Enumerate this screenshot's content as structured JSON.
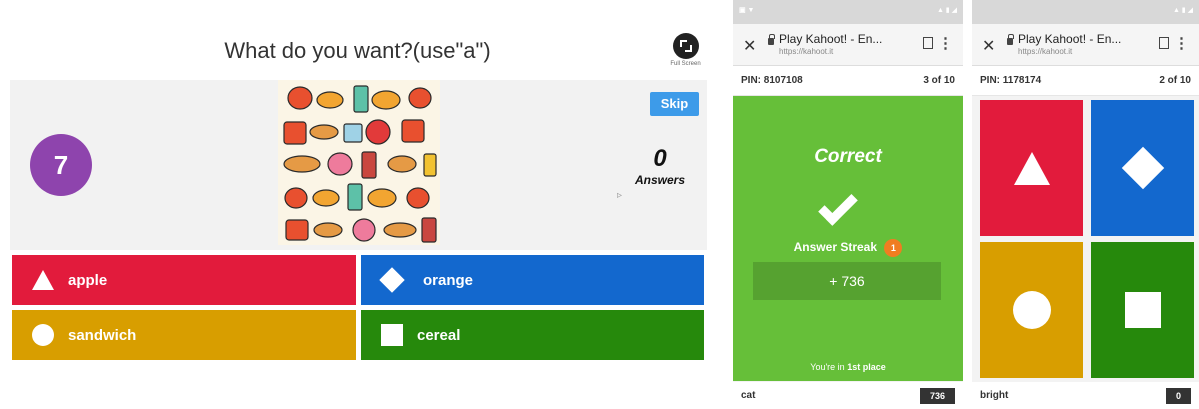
{
  "host": {
    "question": "What do you want?(use\"a\")",
    "fullscreen_label": "Full Screen",
    "timer": "7",
    "skip_label": "Skip",
    "answers_count": "0",
    "answers_label": "Answers",
    "answers": [
      {
        "label": "apple",
        "shape": "triangle-icon",
        "color": "#e21b3c"
      },
      {
        "label": "orange",
        "shape": "diamond-icon",
        "color": "#1368ce"
      },
      {
        "label": "sandwich",
        "shape": "circle-icon",
        "color": "#d89e00"
      },
      {
        "label": "cereal",
        "shape": "square-icon",
        "color": "#26890c"
      }
    ]
  },
  "phone1": {
    "browser_title": "Play Kahoot! - En...",
    "browser_url": "https://kahoot.it",
    "pin": "PIN: 8107108",
    "progress": "3 of 10",
    "result_title": "Correct",
    "streak_label": "Answer Streak",
    "streak_count": "1",
    "score_gain": "+ 736",
    "place_prefix": "You're in",
    "place_value": "1st place",
    "player_name": "cat",
    "player_score": "736",
    "accent_color": "#66bf39"
  },
  "phone2": {
    "browser_title": "Play Kahoot! - En...",
    "browser_url": "https://kahoot.it",
    "pin": "PIN: 1178174",
    "progress": "2 of 10",
    "player_name": "bright",
    "player_score": "0"
  }
}
